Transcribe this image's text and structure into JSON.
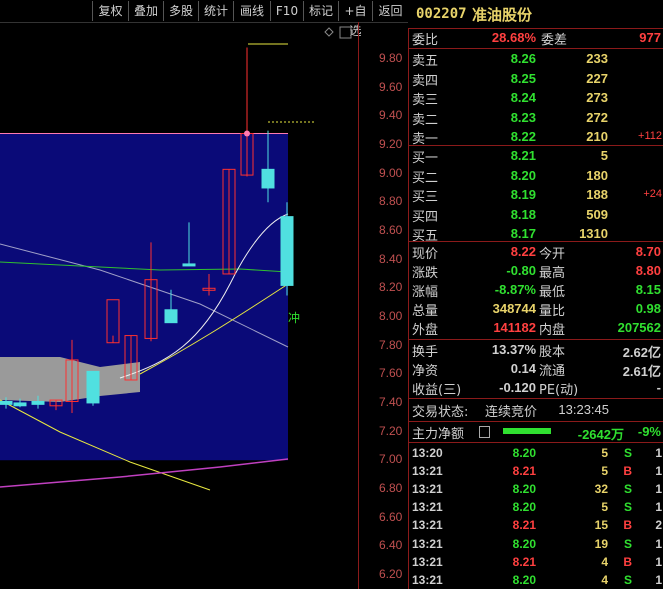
{
  "toolbar": {
    "buttons": [
      "复权",
      "叠加",
      "多股",
      "统计",
      "画线",
      "F10",
      "标记",
      "+自选",
      "返回"
    ]
  },
  "stock": {
    "code": "002207",
    "name": "准油股份"
  },
  "price_axis": {
    "ticks": [
      "9.80",
      "9.60",
      "9.40",
      "9.20",
      "9.00",
      "8.80",
      "8.60",
      "8.40",
      "8.20",
      "8.00",
      "7.80",
      "7.60",
      "7.40",
      "7.20",
      "7.00",
      "6.80",
      "6.60",
      "6.40",
      "6.20"
    ]
  },
  "chart_annotation": "冲",
  "weibi": {
    "label": "委比",
    "value": "28.68%",
    "label2": "委差",
    "value2": "977"
  },
  "asks": [
    {
      "label": "卖五",
      "price": "8.26",
      "vol": "233",
      "chg": ""
    },
    {
      "label": "卖四",
      "price": "8.25",
      "vol": "227",
      "chg": ""
    },
    {
      "label": "卖三",
      "price": "8.24",
      "vol": "273",
      "chg": ""
    },
    {
      "label": "卖二",
      "price": "8.23",
      "vol": "272",
      "chg": ""
    },
    {
      "label": "卖一",
      "price": "8.22",
      "vol": "210",
      "chg": "+112"
    }
  ],
  "bids": [
    {
      "label": "买一",
      "price": "8.21",
      "vol": "5",
      "chg": ""
    },
    {
      "label": "买二",
      "price": "8.20",
      "vol": "180",
      "chg": ""
    },
    {
      "label": "买三",
      "price": "8.19",
      "vol": "188",
      "chg": "+24"
    },
    {
      "label": "买四",
      "price": "8.18",
      "vol": "509",
      "chg": ""
    },
    {
      "label": "买五",
      "price": "8.17",
      "vol": "1310",
      "chg": ""
    }
  ],
  "quote": [
    {
      "l1": "现价",
      "v1": "8.22",
      "c1": "red",
      "l2": "今开",
      "v2": "8.70",
      "c2": "red"
    },
    {
      "l1": "涨跌",
      "v1": "-0.80",
      "c1": "green",
      "l2": "最高",
      "v2": "8.80",
      "c2": "red"
    },
    {
      "l1": "涨幅",
      "v1": "-8.87%",
      "c1": "green",
      "l2": "最低",
      "v2": "8.15",
      "c2": "green"
    },
    {
      "l1": "总量",
      "v1": "348744",
      "c1": "yellow",
      "l2": "量比",
      "v2": "0.98",
      "c2": "green"
    },
    {
      "l1": "外盘",
      "v1": "141182",
      "c1": "red",
      "l2": "内盘",
      "v2": "207562",
      "c2": "green"
    }
  ],
  "stats": [
    {
      "l1": "换手",
      "v1": "13.37%",
      "l2": "股本",
      "v2": "2.62亿"
    },
    {
      "l1": "净资",
      "v1": "0.14",
      "l2": "流通",
      "v2": "2.61亿"
    },
    {
      "l1": "收益(三)",
      "v1": "-0.120",
      "l2": "PE(动)",
      "v2": "-"
    }
  ],
  "trade_status": {
    "label": "交易状态:",
    "status": "连续竞价",
    "time": "13:23:45"
  },
  "main_flow": {
    "label": "主力净额",
    "value": "-2642万",
    "pct": "-9%"
  },
  "ticks": [
    {
      "time": "13:20",
      "price": "8.20",
      "vol": "5",
      "side": "S",
      "n": "1"
    },
    {
      "time": "13:21",
      "price": "8.21",
      "vol": "5",
      "side": "B",
      "n": "1"
    },
    {
      "time": "13:21",
      "price": "8.20",
      "vol": "32",
      "side": "S",
      "n": "1"
    },
    {
      "time": "13:21",
      "price": "8.20",
      "vol": "5",
      "side": "S",
      "n": "1"
    },
    {
      "time": "13:21",
      "price": "8.21",
      "vol": "15",
      "side": "B",
      "n": "2"
    },
    {
      "time": "13:21",
      "price": "8.20",
      "vol": "19",
      "side": "S",
      "n": "1"
    },
    {
      "time": "13:21",
      "price": "8.21",
      "vol": "4",
      "side": "B",
      "n": "1"
    },
    {
      "time": "13:21",
      "price": "8.20",
      "vol": "4",
      "side": "S",
      "n": "1"
    }
  ],
  "chart_data": {
    "type": "candlestick",
    "candles": [
      {
        "o": 7.41,
        "h": 7.44,
        "l": 7.36,
        "c": 7.39
      },
      {
        "o": 7.4,
        "h": 7.43,
        "l": 7.37,
        "c": 7.38
      },
      {
        "o": 7.41,
        "h": 7.45,
        "l": 7.36,
        "c": 7.39
      },
      {
        "o": 7.38,
        "h": 7.42,
        "l": 7.35,
        "c": 7.42
      },
      {
        "o": 7.41,
        "h": 7.84,
        "l": 7.33,
        "c": 7.7
      },
      {
        "o": 7.62,
        "h": 7.62,
        "l": 7.38,
        "c": 7.4
      },
      {
        "o": 7.82,
        "h": 7.87,
        "l": 7.82,
        "c": 8.12
      },
      {
        "o": 7.56,
        "h": 7.87,
        "l": 7.56,
        "c": 7.87
      },
      {
        "o": 7.85,
        "h": 8.52,
        "l": 7.83,
        "c": 8.26
      },
      {
        "o": 8.05,
        "h": 8.19,
        "l": 7.96,
        "c": 7.96
      },
      {
        "o": 8.37,
        "h": 8.66,
        "l": 8.37,
        "c": 8.36
      },
      {
        "o": 8.2,
        "h": 8.3,
        "l": 8.15,
        "c": 8.2
      },
      {
        "o": 8.3,
        "h": 9.03,
        "l": 8.3,
        "c": 9.03
      },
      {
        "o": 8.99,
        "h": 9.88,
        "l": 8.98,
        "c": 9.28
      },
      {
        "o": 9.03,
        "h": 9.3,
        "l": 8.8,
        "c": 8.9
      },
      {
        "o": 8.7,
        "h": 8.8,
        "l": 8.15,
        "c": 8.22
      }
    ]
  }
}
